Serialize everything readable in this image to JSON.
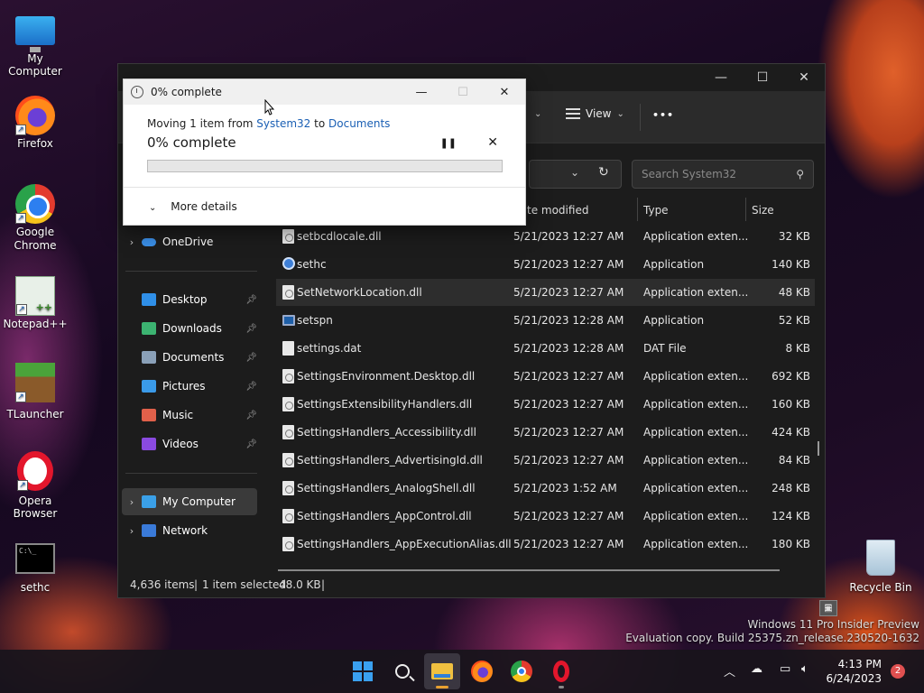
{
  "desktop": {
    "icons": [
      {
        "label": "My Computer",
        "icon": "computer-icon"
      },
      {
        "label": "Firefox",
        "icon": "firefox-icon"
      },
      {
        "label": "Google Chrome",
        "icon": "chrome-icon"
      },
      {
        "label": "Notepad++",
        "icon": "notepad-plus-plus-icon"
      },
      {
        "label": "TLauncher",
        "icon": "tlauncher-icon"
      },
      {
        "label": "Opera Browser",
        "icon": "opera-icon"
      },
      {
        "label": "sethc",
        "icon": "cmd-icon"
      },
      {
        "label": "Recycle Bin",
        "icon": "recycle-bin-icon"
      }
    ]
  },
  "dialog": {
    "title": "0% complete",
    "line_prefix": "Moving 1 item from ",
    "source": "System32",
    "line_mid": " to ",
    "dest": "Documents",
    "percent_text": "0% complete",
    "progress": 0,
    "more_details": "More details",
    "minimize_glyph": "—",
    "maximize_glyph": "☐",
    "close_glyph": "✕",
    "pause_glyph": "❚❚",
    "cancel_glyph": "✕"
  },
  "explorer": {
    "toolbar": {
      "view_label": "View",
      "more_glyph": "•••"
    },
    "search_placeholder": "Search System32",
    "columns": {
      "date": "te modified",
      "type": "Type",
      "size": "Size"
    },
    "nav": {
      "onedrive": "OneDrive",
      "quick": [
        {
          "label": "Desktop",
          "color": "#2f8fe8"
        },
        {
          "label": "Downloads",
          "color": "#3cb371"
        },
        {
          "label": "Documents",
          "color": "#8aa0b8"
        },
        {
          "label": "Pictures",
          "color": "#3a9ae8"
        },
        {
          "label": "Music",
          "color": "#e0604a"
        },
        {
          "label": "Videos",
          "color": "#8a4ae0"
        }
      ],
      "my_computer": "My Computer",
      "network": "Network"
    },
    "files": [
      {
        "name": "setbcdlocale.dll",
        "date": "5/21/2023 12:27 AM",
        "type": "Application exten...",
        "size": "32 KB",
        "kind": "dll"
      },
      {
        "name": "sethc",
        "date": "5/21/2023 12:27 AM",
        "type": "Application",
        "size": "140 KB",
        "kind": "app"
      },
      {
        "name": "SetNetworkLocation.dll",
        "date": "5/21/2023 12:27 AM",
        "type": "Application exten...",
        "size": "48 KB",
        "kind": "dll"
      },
      {
        "name": "setspn",
        "date": "5/21/2023 12:28 AM",
        "type": "Application",
        "size": "52 KB",
        "kind": "app2"
      },
      {
        "name": "settings.dat",
        "date": "5/21/2023 12:28 AM",
        "type": "DAT File",
        "size": "8 KB",
        "kind": "file"
      },
      {
        "name": "SettingsEnvironment.Desktop.dll",
        "date": "5/21/2023 12:27 AM",
        "type": "Application exten...",
        "size": "692 KB",
        "kind": "dll"
      },
      {
        "name": "SettingsExtensibilityHandlers.dll",
        "date": "5/21/2023 12:27 AM",
        "type": "Application exten...",
        "size": "160 KB",
        "kind": "dll"
      },
      {
        "name": "SettingsHandlers_Accessibility.dll",
        "date": "5/21/2023 12:27 AM",
        "type": "Application exten...",
        "size": "424 KB",
        "kind": "dll"
      },
      {
        "name": "SettingsHandlers_AdvertisingId.dll",
        "date": "5/21/2023 12:27 AM",
        "type": "Application exten...",
        "size": "84 KB",
        "kind": "dll"
      },
      {
        "name": "SettingsHandlers_AnalogShell.dll",
        "date": "5/21/2023 1:52 AM",
        "type": "Application exten...",
        "size": "248 KB",
        "kind": "dll"
      },
      {
        "name": "SettingsHandlers_AppControl.dll",
        "date": "5/21/2023 12:27 AM",
        "type": "Application exten...",
        "size": "124 KB",
        "kind": "dll"
      },
      {
        "name": "SettingsHandlers_AppExecutionAlias.dll",
        "date": "5/21/2023 12:27 AM",
        "type": "Application exten...",
        "size": "180 KB",
        "kind": "dll"
      }
    ],
    "hovered_index": 2,
    "status": {
      "count": "4,636 items",
      "selected": "1 item selected",
      "size": "48.0 KB"
    }
  },
  "watermark": {
    "line1": "Windows 11 Pro Insider Preview",
    "line2": "Evaluation copy. Build 25375.zn_release.230520-1632"
  },
  "taskbar": {
    "time": "4:13 PM",
    "date": "6/24/2023",
    "notifications": "2"
  }
}
